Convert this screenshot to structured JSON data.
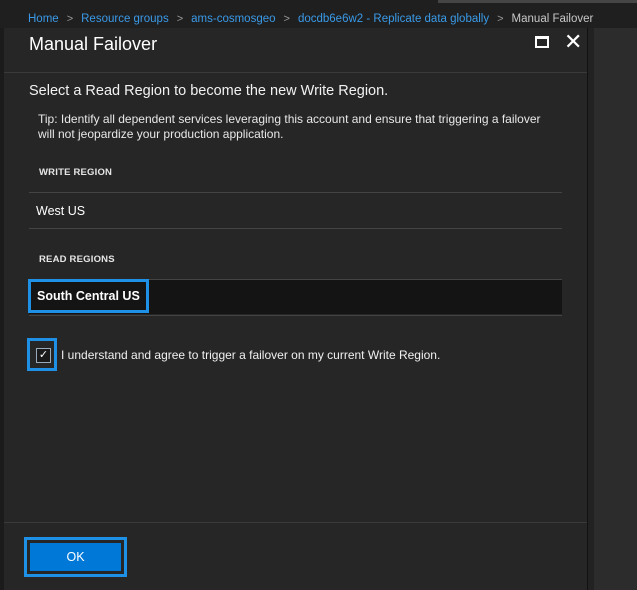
{
  "breadcrumb": {
    "items": [
      {
        "label": "Home"
      },
      {
        "label": "Resource groups"
      },
      {
        "label": "ams-cosmosgeo"
      },
      {
        "label": "docdb6e6w2 - Replicate data globally"
      },
      {
        "label": "Manual Failover"
      }
    ],
    "separator": ">"
  },
  "blade": {
    "title": "Manual Failover",
    "maximize_icon": "maximize-icon",
    "close_icon": "close-icon",
    "close_glyph": "✕"
  },
  "content": {
    "intro": "Select a Read Region to become the new Write Region.",
    "tip": "Tip: Identify all dependent services leveraging this account and ensure that triggering a failover will not jeopardize your production application.",
    "write_region_label": "WRITE REGION",
    "write_region_value": "West US",
    "read_regions_label": "READ REGIONS",
    "read_regions": [
      "South Central US"
    ],
    "agree_checked": true,
    "agree_text": "I understand and agree to trigger a failover on my current Write Region."
  },
  "footer": {
    "ok_label": "OK"
  },
  "colors": {
    "accent": "#1e90e6",
    "link": "#3a9ae8",
    "button": "#0078d7",
    "panel": "#262626"
  }
}
